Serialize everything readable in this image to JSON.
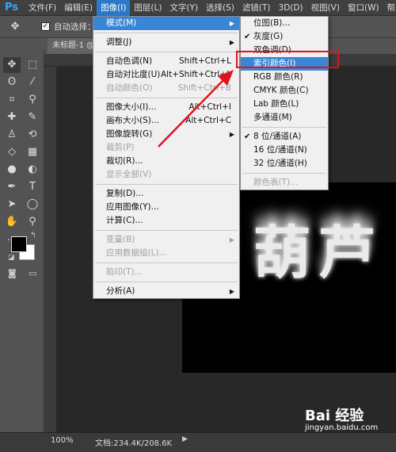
{
  "menubar": {
    "logo": "Ps",
    "items": [
      "文件(F)",
      "编辑(E)",
      "图像(I)",
      "图层(L)",
      "文字(Y)",
      "选择(S)",
      "滤镜(T)",
      "3D(D)",
      "视图(V)",
      "窗口(W)",
      "帮助"
    ]
  },
  "options": {
    "auto_select": "自动选择：",
    "move_icon": "move-tool-icon"
  },
  "document": {
    "tab_title": "未标题-1 @"
  },
  "canvas": {
    "text": "葫芦",
    "background": "#000000"
  },
  "status": {
    "zoom": "100%",
    "docinfo": "文档:234.4K/208.6K",
    "arrow": "▶"
  },
  "image_menu": {
    "rows": [
      {
        "label": "模式(M)",
        "shortcut": "",
        "submenu": true,
        "disabled": false,
        "highlight": true
      },
      {
        "sep": true
      },
      {
        "label": "调整(J)",
        "shortcut": "",
        "submenu": true,
        "disabled": false
      },
      {
        "sep": true
      },
      {
        "label": "自动色调(N)",
        "shortcut": "Shift+Ctrl+L",
        "disabled": false
      },
      {
        "label": "自动对比度(U)",
        "shortcut": "Alt+Shift+Ctrl+L",
        "disabled": false
      },
      {
        "label": "自动颜色(O)",
        "shortcut": "Shift+Ctrl+B",
        "disabled": true
      },
      {
        "sep": true
      },
      {
        "label": "图像大小(I)...",
        "shortcut": "Alt+Ctrl+I",
        "disabled": false
      },
      {
        "label": "画布大小(S)...",
        "shortcut": "Alt+Ctrl+C",
        "disabled": false
      },
      {
        "label": "图像旋转(G)",
        "shortcut": "",
        "submenu": true,
        "disabled": false
      },
      {
        "label": "裁剪(P)",
        "shortcut": "",
        "disabled": true
      },
      {
        "label": "裁切(R)...",
        "shortcut": "",
        "disabled": false
      },
      {
        "label": "显示全部(V)",
        "shortcut": "",
        "disabled": true
      },
      {
        "sep": true
      },
      {
        "label": "复制(D)...",
        "shortcut": "",
        "disabled": false
      },
      {
        "label": "应用图像(Y)...",
        "shortcut": "",
        "disabled": false
      },
      {
        "label": "计算(C)...",
        "shortcut": "",
        "disabled": false
      },
      {
        "sep": true
      },
      {
        "label": "变量(B)",
        "shortcut": "",
        "submenu": true,
        "disabled": true
      },
      {
        "label": "应用数据组(L)...",
        "shortcut": "",
        "disabled": true
      },
      {
        "sep": true
      },
      {
        "label": "陷印(T)...",
        "shortcut": "",
        "disabled": true
      },
      {
        "sep": true
      },
      {
        "label": "分析(A)",
        "shortcut": "",
        "submenu": true,
        "disabled": false
      }
    ]
  },
  "mode_menu": {
    "rows": [
      {
        "label": "位图(B)...",
        "checked": false,
        "disabled": false
      },
      {
        "label": "灰度(G)",
        "checked": true,
        "disabled": false
      },
      {
        "label": "双色调(D)...",
        "checked": false,
        "disabled": false
      },
      {
        "label": "索引颜色(I)",
        "checked": false,
        "disabled": false,
        "highlight": true
      },
      {
        "label": "RGB 颜色(R)",
        "checked": false,
        "disabled": false
      },
      {
        "label": "CMYK 颜色(C)",
        "checked": false,
        "disabled": false
      },
      {
        "label": "Lab 颜色(L)",
        "checked": false,
        "disabled": false
      },
      {
        "label": "多通道(M)",
        "checked": false,
        "disabled": false
      },
      {
        "sep": true
      },
      {
        "label": "8 位/通道(A)",
        "checked": true,
        "disabled": false
      },
      {
        "label": "16 位/通道(N)",
        "checked": false,
        "disabled": false
      },
      {
        "label": "32 位/通道(H)",
        "checked": false,
        "disabled": false
      },
      {
        "sep": true
      },
      {
        "label": "颜色表(T)...",
        "checked": false,
        "disabled": true
      }
    ]
  },
  "watermark": {
    "logo": "Bai 经验",
    "url": "jingyan.baidu.com"
  },
  "colors": {
    "highlight": "#3a86d6",
    "annotation_red": "#e0141e",
    "menubar": "#404040"
  }
}
